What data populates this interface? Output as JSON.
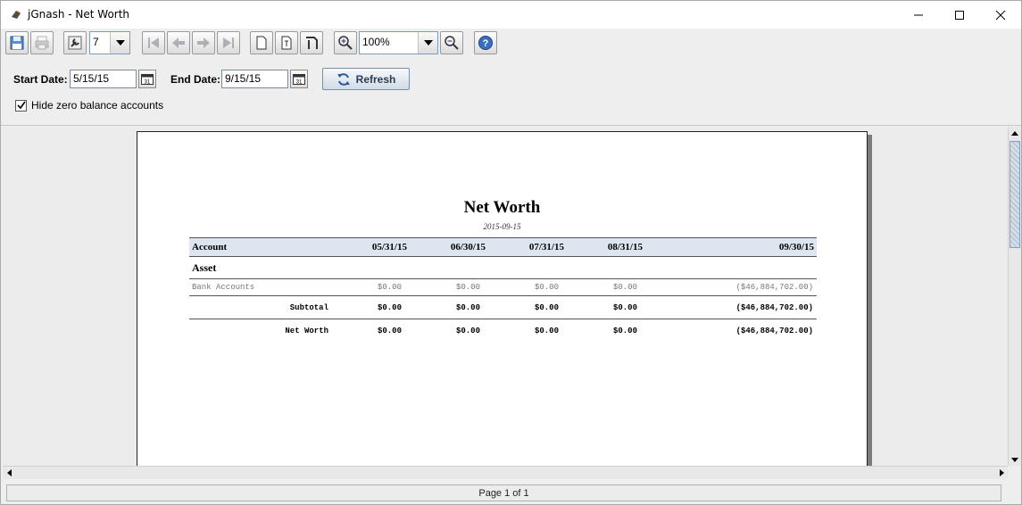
{
  "window": {
    "title": "jGnash - Net Worth"
  },
  "toolbar": {
    "page_select_value": "7",
    "zoom_value": "100%"
  },
  "params": {
    "start_label": "Start Date:",
    "start_value": "5/15/15",
    "end_label": "End Date:",
    "end_value": "9/15/15",
    "calendar_glyph": "31",
    "refresh_label": "Refresh",
    "hide_zero_label": "Hide zero balance accounts",
    "hide_zero_checked": true
  },
  "report": {
    "title": "Net Worth",
    "date": "2015-09-15",
    "columns": [
      "Account",
      "05/31/15",
      "06/30/15",
      "07/31/15",
      "08/31/15",
      "09/30/15"
    ],
    "group": "Asset",
    "rows": [
      {
        "account": "Bank Accounts",
        "values": [
          "$0.00",
          "$0.00",
          "$0.00",
          "$0.00",
          "($46,884,702.00)"
        ]
      }
    ],
    "subtotal": {
      "label": "Subtotal",
      "values": [
        "$0.00",
        "$0.00",
        "$0.00",
        "$0.00",
        "($46,884,702.00)"
      ]
    },
    "total": {
      "label": "Net Worth",
      "values": [
        "$0.00",
        "$0.00",
        "$0.00",
        "$0.00",
        "($46,884,702.00)"
      ]
    }
  },
  "status": {
    "page_text": "Page 1 of 1"
  },
  "colors": {
    "header_bg": "#dde5ef",
    "page_bg": "#ffffff",
    "accent": "#2a5aa0"
  }
}
